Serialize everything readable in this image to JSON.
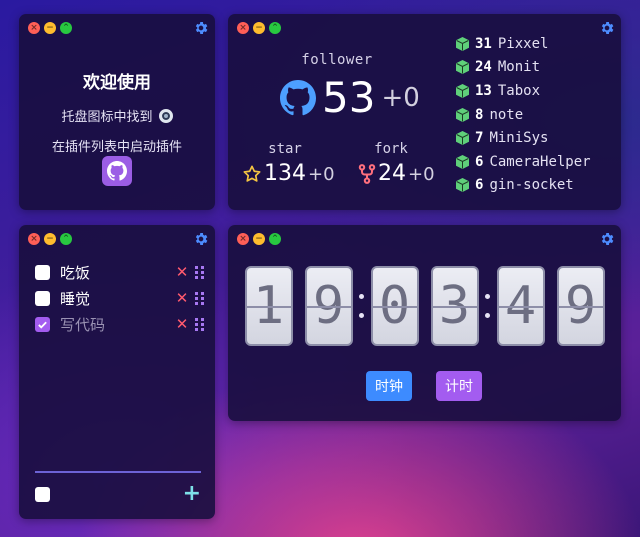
{
  "welcome": {
    "title": "欢迎使用",
    "line1": "托盘图标中找到",
    "line2": "在插件列表中启动插件"
  },
  "github": {
    "follower_label": "follower",
    "follower_count": "53",
    "follower_delta": "+0",
    "star_label": "star",
    "star_count": "134",
    "star_delta": "+0",
    "fork_label": "fork",
    "fork_count": "24",
    "fork_delta": "+0",
    "repos": [
      {
        "count": "31",
        "name": "Pixxel"
      },
      {
        "count": "24",
        "name": "Monit"
      },
      {
        "count": "13",
        "name": "Tabox"
      },
      {
        "count": "8",
        "name": "note"
      },
      {
        "count": "7",
        "name": "MiniSys"
      },
      {
        "count": "6",
        "name": "CameraHelper"
      },
      {
        "count": "6",
        "name": "gin-socket"
      }
    ]
  },
  "todo": {
    "items": [
      {
        "text": "吃饭",
        "checked": false
      },
      {
        "text": "睡觉",
        "checked": false
      },
      {
        "text": "写代码",
        "checked": true
      }
    ],
    "add_label": "+"
  },
  "clock": {
    "digits": [
      "1",
      "9",
      "0",
      "3",
      "4",
      "9"
    ],
    "clock_button": "时钟",
    "timer_button": "计时"
  },
  "window_controls": {
    "close": "×",
    "minimize": "−",
    "maximize": "⌃"
  },
  "colors": {
    "accent_blue": "#3d8bff",
    "accent_purple": "#a35cf0",
    "delete_red": "#ff5a6e",
    "add_cyan": "#7ee0e8",
    "repo_icon_green": "#5fd07a"
  }
}
